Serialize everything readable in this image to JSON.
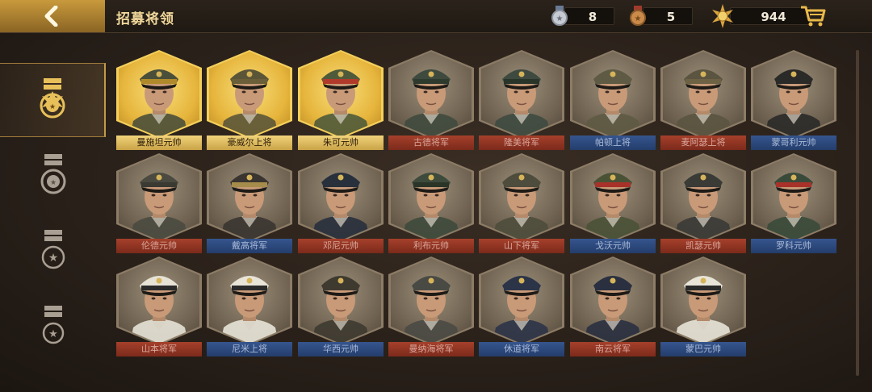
{
  "header": {
    "title": "招募将领",
    "currencies": [
      {
        "icon": "silver-medal-icon",
        "value": "8"
      },
      {
        "icon": "bronze-medal-icon",
        "value": "5"
      },
      {
        "icon": "gold-badge-icon",
        "value": "944"
      }
    ]
  },
  "sidebar": {
    "tabs": [
      {
        "icon": "rank-five-star-icon",
        "active": true
      },
      {
        "icon": "rank-four-star-icon",
        "active": false
      },
      {
        "icon": "rank-three-star-icon",
        "active": false
      },
      {
        "icon": "rank-one-star-icon",
        "active": false
      }
    ]
  },
  "generals": [
    {
      "name": "曼施坦元帅",
      "frame": "gold",
      "bar": "gold",
      "cap": "#4a4f3a",
      "band": "#b08a2a"
    },
    {
      "name": "豪威尔上将",
      "frame": "gold",
      "bar": "gold",
      "cap": "#5b5538",
      "band": "#6b5f3a"
    },
    {
      "name": "朱可元帅",
      "frame": "gold",
      "bar": "gold",
      "cap": "#4f5a3a",
      "band": "#b23a2a"
    },
    {
      "name": "古德将军",
      "frame": "plain",
      "bar": "red",
      "cap": "#3f4a3e",
      "band": "#2e3a2e"
    },
    {
      "name": "隆美将军",
      "frame": "plain",
      "bar": "red",
      "cap": "#3e4a40",
      "band": "#2a3529"
    },
    {
      "name": "帕顿上将",
      "frame": "plain",
      "bar": "blue",
      "cap": "#5e5a44",
      "band": "#5e5a44"
    },
    {
      "name": "麦阿瑟上将",
      "frame": "plain",
      "bar": "red",
      "cap": "#5a5440",
      "band": "#6e6244"
    },
    {
      "name": "蒙哥利元帅",
      "frame": "plain",
      "bar": "blue",
      "cap": "#2a2a28",
      "band": "#2a2a28"
    },
    {
      "name": "伦德元帅",
      "frame": "plain",
      "bar": "red",
      "cap": "#4a4a40",
      "band": "#3a3a32"
    },
    {
      "name": "戴高将军",
      "frame": "plain",
      "bar": "blue",
      "cap": "#3a3530",
      "band": "#a68c4a"
    },
    {
      "name": "邓尼元帅",
      "frame": "plain",
      "bar": "red",
      "cap": "#28303c",
      "band": "#28303c"
    },
    {
      "name": "利布元帅",
      "frame": "plain",
      "bar": "red",
      "cap": "#3e4a3c",
      "band": "#2a3528"
    },
    {
      "name": "山下将军",
      "frame": "plain",
      "bar": "red",
      "cap": "#4e4c3c",
      "band": "#4e4c3c"
    },
    {
      "name": "戈沃元帅",
      "frame": "plain",
      "bar": "blue",
      "cap": "#4a5236",
      "band": "#a8322a"
    },
    {
      "name": "凯瑟元帅",
      "frame": "plain",
      "bar": "red",
      "cap": "#3a3a36",
      "band": "#3a3a36"
    },
    {
      "name": "罗科元帅",
      "frame": "plain",
      "bar": "blue",
      "cap": "#3a4a3a",
      "band": "#a8322a"
    },
    {
      "name": "山本将军",
      "frame": "plain",
      "bar": "red",
      "cap": "#e6e2d6",
      "band": "#2a2a2a"
    },
    {
      "name": "尼米上将",
      "frame": "plain",
      "bar": "blue",
      "cap": "#e8e4d8",
      "band": "#2a2a2a"
    },
    {
      "name": "华西元帅",
      "frame": "plain",
      "bar": "blue",
      "cap": "#3e3a30",
      "band": "#3e3a30"
    },
    {
      "name": "曼纳海将军",
      "frame": "plain",
      "bar": "red",
      "cap": "#4a4a44",
      "band": "#4a4a44"
    },
    {
      "name": "休道将军",
      "frame": "plain",
      "bar": "blue",
      "cap": "#2c3448",
      "band": "#2c3448"
    },
    {
      "name": "南云将军",
      "frame": "plain",
      "bar": "red",
      "cap": "#2a3040",
      "band": "#2a3040"
    },
    {
      "name": "蒙巴元帅",
      "frame": "plain",
      "bar": "blue",
      "cap": "#e8e4d8",
      "band": "#2a2a2a"
    }
  ]
}
